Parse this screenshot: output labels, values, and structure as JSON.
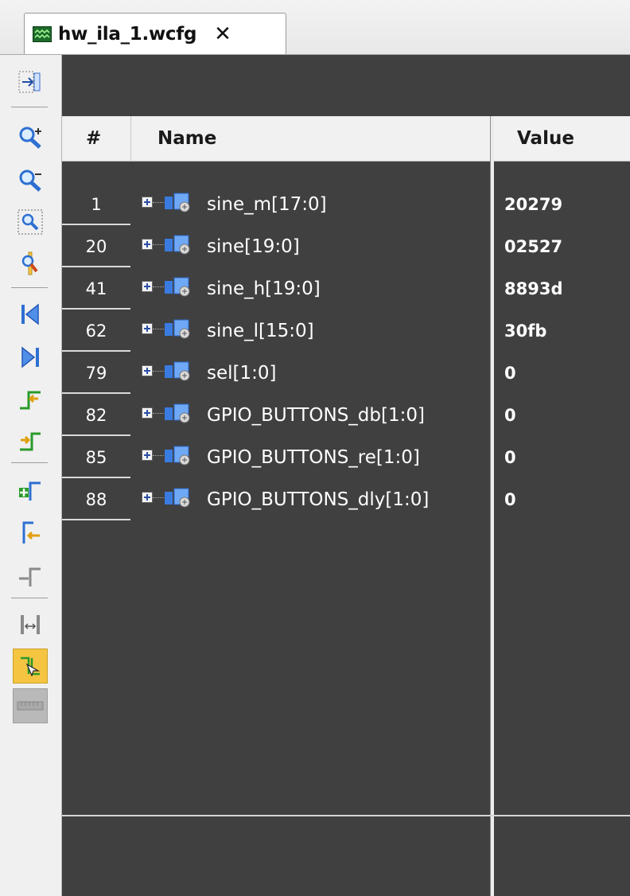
{
  "tab": {
    "title": "hw_ila_1.wcfg",
    "close": "✕",
    "icon": "waveform-icon"
  },
  "toolbar": {
    "buttons": [
      "zoom-fit-icon",
      "zoom-in-icon",
      "zoom-out-icon",
      "zoom-area-icon",
      "go-to-cursor-icon",
      "go-to-time-0-icon",
      "go-to-last-time-icon",
      "previous-transition-icon",
      "next-transition-icon",
      "add-marker-icon",
      "previous-marker-icon",
      "next-marker-icon",
      "swap-cursors-icon",
      "snap-to-transition-icon",
      "floating-ruler-icon"
    ]
  },
  "columns": {
    "num": "#",
    "name": "Name",
    "value": "Value"
  },
  "signals": [
    {
      "num": "1",
      "name": "sine_m[17:0]",
      "value": "20279"
    },
    {
      "num": "20",
      "name": "sine[19:0]",
      "value": "02527"
    },
    {
      "num": "41",
      "name": "sine_h[19:0]",
      "value": "8893d"
    },
    {
      "num": "62",
      "name": "sine_l[15:0]",
      "value": "30fb"
    },
    {
      "num": "79",
      "name": "sel[1:0]",
      "value": "0"
    },
    {
      "num": "82",
      "name": "GPIO_BUTTONS_db[1:0]",
      "value": "0"
    },
    {
      "num": "85",
      "name": "GPIO_BUTTONS_re[1:0]",
      "value": "0"
    },
    {
      "num": "88",
      "name": "GPIO_BUTTONS_dly[1:0]",
      "value": "0"
    }
  ],
  "colors": {
    "panel_bg": "#404040",
    "text": "#ffffff",
    "active_button": "#f5c542"
  }
}
